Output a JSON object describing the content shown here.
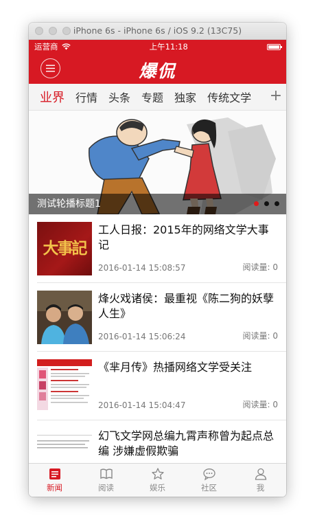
{
  "window": {
    "title": "iPhone 6s - iPhone 6s / iOS 9.2 (13C75)"
  },
  "status_bar": {
    "carrier": "运营商",
    "time": "上午11:18"
  },
  "nav": {
    "logo_text": "爆侃",
    "accent_color": "#d71923"
  },
  "channels": {
    "items": [
      "业界",
      "行情",
      "头条",
      "专题",
      "独家",
      "传统文学"
    ],
    "active_index": 0,
    "add_label": "+"
  },
  "banner": {
    "caption": "测试轮播标题1",
    "page_count": 3,
    "current_page": 1
  },
  "news": [
    {
      "title": "工人日报：2015年的网络文学大事记",
      "date": "2016-01-14 15:08:57",
      "reads": "阅读量: 0",
      "thumb_text": "大事記"
    },
    {
      "title": "烽火戏诸侯：最重视《陈二狗的妖孽人生》",
      "date": "2016-01-14 15:06:24",
      "reads": "阅读量: 0"
    },
    {
      "title": "《芈月传》热播网络文学受关注",
      "date": "2016-01-14 15:04:47",
      "reads": "阅读量: 0"
    },
    {
      "title": "幻飞文学网总编九霄声称曾为起点总编 涉嫌虚假欺骗",
      "date": "",
      "reads": ""
    }
  ],
  "tabbar": {
    "items": [
      {
        "label": "新闻",
        "icon": "news-icon"
      },
      {
        "label": "阅读",
        "icon": "book-icon"
      },
      {
        "label": "娱乐",
        "icon": "star-icon"
      },
      {
        "label": "社区",
        "icon": "chat-icon"
      },
      {
        "label": "我",
        "icon": "person-icon"
      }
    ],
    "active_index": 0
  }
}
